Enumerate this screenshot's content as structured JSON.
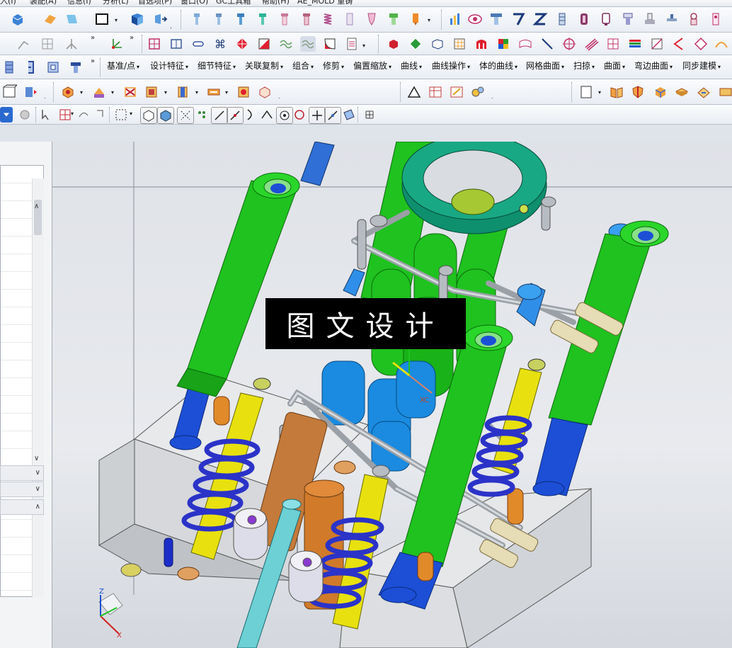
{
  "title_strip": {
    "menus": [
      "入(I)",
      "装配(A)",
      "信息(I)",
      "分析(L)",
      "首选项(P)",
      "窗口(O)",
      "GC工具箱",
      "帮助(H)",
      "AE_MOLD 重铸"
    ]
  },
  "feature_menu": {
    "items": [
      "基准/点",
      "设计特征",
      "细节特征",
      "关联复制",
      "组合",
      "修剪",
      "偏置缩放",
      "曲线",
      "曲线操作",
      "体的曲线",
      "网格曲面",
      "扫掠",
      "曲面",
      "弯边曲面",
      "同步建模"
    ]
  },
  "watermark": {
    "text": "图文设计"
  },
  "viewport": {
    "wcs_label": "XC",
    "triad_z_label": "Z",
    "triad_x_label": "X"
  },
  "colors": {
    "guide_pillar": "#1fc21f",
    "bushing_blue": "#1c4fd6",
    "spring_blue": "#2b33c8",
    "spring_yellow": "#e8e10f",
    "block_gray": "#d9dadc",
    "ring_teal": "#0e8f6e",
    "bolt_light_blue": "#2f8fe8",
    "copper": "#c47a3a",
    "orange": "#e08a2a"
  }
}
